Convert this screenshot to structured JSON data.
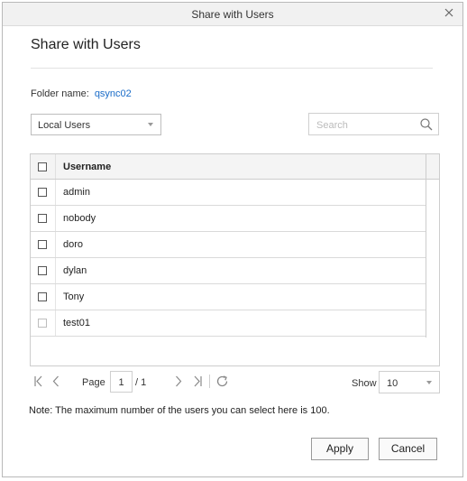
{
  "window": {
    "title": "Share with Users",
    "close_icon": "close-icon"
  },
  "dialog": {
    "heading": "Share with Users",
    "folder_label": "Folder name:",
    "folder_value": "qsync02"
  },
  "filter": {
    "user_type": "Local Users"
  },
  "search": {
    "placeholder": "Search",
    "icon": "search-icon"
  },
  "table": {
    "header": "Username",
    "rows": [
      {
        "name": "admin"
      },
      {
        "name": "nobody"
      },
      {
        "name": "doro"
      },
      {
        "name": "dylan"
      },
      {
        "name": "Tony"
      },
      {
        "name": "test01"
      }
    ]
  },
  "pagination": {
    "page_label": "Page",
    "current_page": "1",
    "total_pages": "/ 1",
    "show_label": "Show",
    "show_value": "10"
  },
  "note": "Note: The maximum number of the users you can select here is 100.",
  "buttons": {
    "apply": "Apply",
    "cancel": "Cancel"
  }
}
